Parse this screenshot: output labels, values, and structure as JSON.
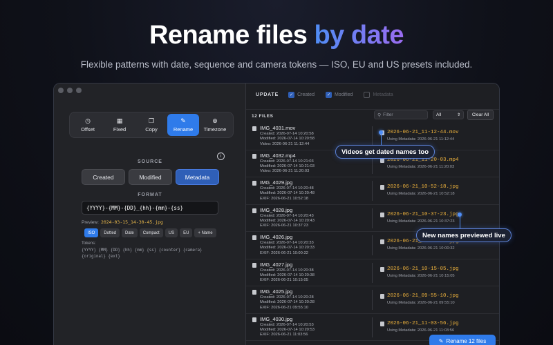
{
  "hero": {
    "title_main": "Rename files ",
    "title_accent": "by date",
    "subtitle": "Flexible patterns with date, sequence and camera tokens — ISO, EU and US presets included."
  },
  "modes": [
    {
      "label": "Offset",
      "icon": "clock-icon",
      "glyph": "◷"
    },
    {
      "label": "Fixed",
      "icon": "calendar-icon",
      "glyph": "▦"
    },
    {
      "label": "Copy",
      "icon": "copy-icon",
      "glyph": "❐"
    },
    {
      "label": "Rename",
      "icon": "pencil-icon",
      "glyph": "✎"
    },
    {
      "label": "Timezone",
      "icon": "globe-icon",
      "glyph": "⊕"
    }
  ],
  "active_mode": "Rename",
  "source": {
    "label": "SOURCE",
    "options": [
      "Created",
      "Modified",
      "Metadata"
    ],
    "selected": "Metadata"
  },
  "format": {
    "label": "FORMAT",
    "value": "{YYYY}-{MM}-{DD}_{hh}-{mm}-{ss}",
    "preview_label": "Preview:",
    "preview_value": "2024-03-15_14-30-45.jpg"
  },
  "presets": [
    "ISO",
    "Dotted",
    "Date",
    "Compact",
    "US",
    "EU",
    "+ Name"
  ],
  "active_preset": "ISO",
  "tokens": {
    "label": "Tokens:",
    "list": "{YYYY} {MM} {DD} {hh} {mm} {ss} {counter} {camera} {original} {ext}"
  },
  "update": {
    "label": "UPDATE",
    "options": [
      {
        "label": "Created",
        "checked": true
      },
      {
        "label": "Modified",
        "checked": true
      },
      {
        "label": "Metadata",
        "checked": false
      }
    ]
  },
  "files": {
    "count_label": "12 FILES",
    "filter_placeholder": "Filter",
    "filter_select": "All",
    "clear_label": "Clear All",
    "items": [
      {
        "name": "IMG_4031.mov",
        "created": "Created: 2026-07-14 10:20:58",
        "modified": "Modified: 2026-07-14 10:20:58",
        "extra": "Video: 2026-06-21 11:12:44",
        "new_name": "2026-06-21_11-12-44.mov",
        "using": "Using Metadata: 2026-06-21 11:12:44"
      },
      {
        "name": "IMG_4032.mp4",
        "created": "Created: 2026-07-14 10:21:03",
        "modified": "Modified: 2026-07-14 10:21:03",
        "extra": "Video: 2026-06-21 11:20:03",
        "new_name": "2026-06-21_11-20-03.mp4",
        "using": "Using Metadata: 2026-06-21 11:20:03"
      },
      {
        "name": "IMG_4029.jpg",
        "created": "Created: 2026-07-14 10:20:48",
        "modified": "Modified: 2026-07-14 10:20:48",
        "extra": "EXIF: 2026-06-21 10:52:18",
        "new_name": "2026-06-21_10-52-18.jpg",
        "using": "Using Metadata: 2026-06-21 10:52:18"
      },
      {
        "name": "IMG_4028.jpg",
        "created": "Created: 2026-07-14 10:20:43",
        "modified": "Modified: 2026-07-14 10:20:43",
        "extra": "EXIF: 2026-06-21 10:37:23",
        "new_name": "2026-06-21_10-37-23.jpg",
        "using": "Using Metadata: 2026-06-21 10:37:23"
      },
      {
        "name": "IMG_4026.jpg",
        "created": "Created: 2026-07-14 10:20:33",
        "modified": "Modified: 2026-07-14 10:20:33",
        "extra": "EXIF: 2026-06-21 10:00:32",
        "new_name": "2026-06-21_10-00-32.jpg",
        "using": "Using Metadata: 2026-06-21 10:00:32"
      },
      {
        "name": "IMG_4027.jpg",
        "created": "Created: 2026-07-14 10:20:38",
        "modified": "Modified: 2026-07-14 10:20:38",
        "extra": "EXIF: 2026-06-21 10:15:05",
        "new_name": "2026-06-21_10-15-05.jpg",
        "using": "Using Metadata: 2026-06-21 10:15:05"
      },
      {
        "name": "IMG_4025.jpg",
        "created": "Created: 2026-07-14 10:20:28",
        "modified": "Modified: 2026-07-14 10:20:28",
        "extra": "EXIF: 2026-06-21 09:55:10",
        "new_name": "2026-06-21_09-55-10.jpg",
        "using": "Using Metadata: 2026-06-21 09:55:10"
      },
      {
        "name": "IMG_4030.jpg",
        "created": "Created: 2026-07-14 10:20:53",
        "modified": "Modified: 2026-07-14 10:20:53",
        "extra": "EXIF: 2026-06-21 11:03:56",
        "new_name": "2026-06-21_11-03-56.jpg",
        "using": "Using Metadata: 2026-06-21 11:03:56"
      }
    ]
  },
  "rename_button": "Rename 12 files",
  "callouts": {
    "video": "Videos get dated names too",
    "preview": "New names previewed live"
  },
  "colors": {
    "accent": "#2f7bea",
    "new_name": "#f0b43d",
    "title_gradient_start": "#4f8df5",
    "title_gradient_end": "#9a6cf0"
  }
}
